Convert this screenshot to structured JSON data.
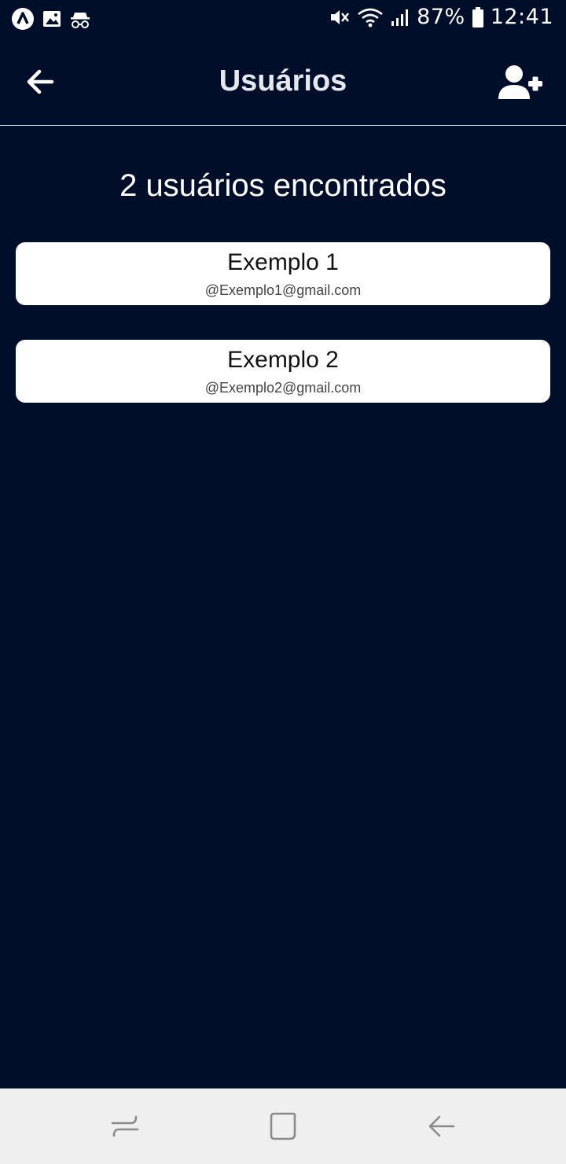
{
  "status_bar": {
    "battery": "87%",
    "time": "12:41",
    "icons": [
      "app-logo-icon",
      "gallery-icon",
      "incognito-icon",
      "mute-icon",
      "wifi-icon",
      "signal-icon",
      "battery-icon"
    ]
  },
  "header": {
    "title": "Usuários",
    "back_icon": "arrow-left-icon",
    "add_icon": "user-plus-icon"
  },
  "main": {
    "count_label": "2 usuários encontrados",
    "users": [
      {
        "name": "Exemplo 1",
        "email": "@Exemplo1@gmail.com"
      },
      {
        "name": "Exemplo 2",
        "email": "@Exemplo2@gmail.com"
      }
    ]
  },
  "nav_bar": {
    "icons": [
      "recents-icon",
      "home-icon",
      "back-icon"
    ]
  },
  "colors": {
    "background": "#000e29",
    "card": "#ffffff",
    "nav_bar": "#efefef"
  }
}
